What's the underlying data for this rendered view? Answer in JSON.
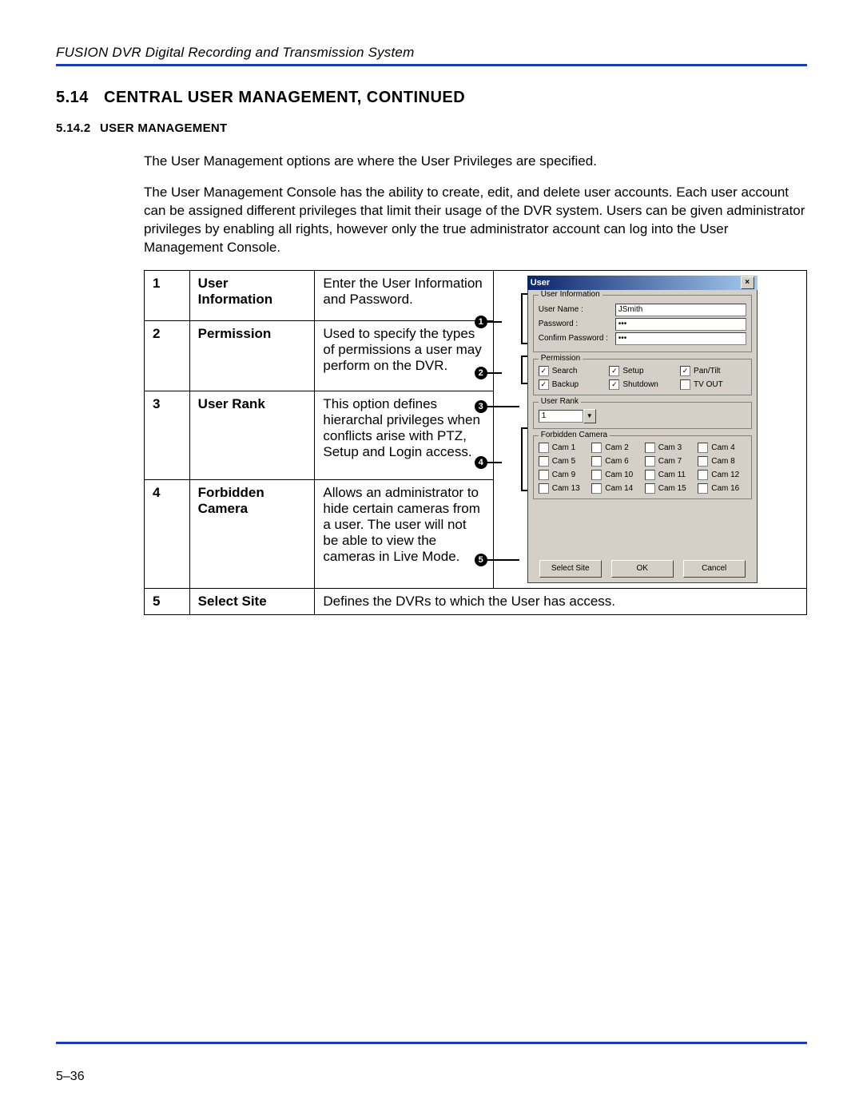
{
  "header": "FUSION DVR Digital Recording and Transmission System",
  "section": {
    "num": "5.14",
    "title": "CENTRAL USER MANAGEMENT, CONTINUED"
  },
  "subsection": {
    "num": "5.14.2",
    "title": "USER MANAGEMENT"
  },
  "para1": "The User Management options are where the User Privileges are specified.",
  "para2": "The User Management Console has the ability to create, edit, and delete user accounts. Each user account can be assigned different privileges that limit their usage of the DVR system. Users can be given administrator privileges by enabling all rights, however only the true administrator account can log into the User Management Console.",
  "defs": [
    {
      "n": "1",
      "term": "User Information",
      "desc": "Enter the User Information and Password."
    },
    {
      "n": "2",
      "term": "Permission",
      "desc": "Used to specify the types of permissions a user may perform on the DVR."
    },
    {
      "n": "3",
      "term": "User Rank",
      "desc": "This option defines hierarchal privileges when conflicts arise with PTZ, Setup and Login access."
    },
    {
      "n": "4",
      "term": "Forbidden Camera",
      "desc": "Allows an administrator to hide certain cameras from a user. The user will not be able to view the cameras in Live Mode."
    },
    {
      "n": "5",
      "term": "Select Site",
      "desc": "Defines the DVRs to which the User has access."
    }
  ],
  "dialog": {
    "title": "User",
    "group_userinfo": "User Information",
    "lbl_username": "User Name :",
    "val_username": "JSmith",
    "lbl_password": "Password :",
    "val_password": "•••",
    "lbl_confirm": "Confirm Password :",
    "val_confirm": "•••",
    "group_permission": "Permission",
    "perm": [
      {
        "label": "Search",
        "checked": true
      },
      {
        "label": "Setup",
        "checked": true
      },
      {
        "label": "Pan/Tilt",
        "checked": true
      },
      {
        "label": "Backup",
        "checked": true
      },
      {
        "label": "Shutdown",
        "checked": true
      },
      {
        "label": "TV OUT",
        "checked": false
      }
    ],
    "group_rank": "User Rank",
    "rank_value": "1",
    "group_forbidden": "Forbidden Camera",
    "cams": [
      "Cam 1",
      "Cam 2",
      "Cam 3",
      "Cam 4",
      "Cam 5",
      "Cam 6",
      "Cam 7",
      "Cam 8",
      "Cam 9",
      "Cam 10",
      "Cam 11",
      "Cam 12",
      "Cam 13",
      "Cam 14",
      "Cam 15",
      "Cam 16"
    ],
    "btn_select_site": "Select Site",
    "btn_ok": "OK",
    "btn_cancel": "Cancel"
  },
  "callouts": [
    "1",
    "2",
    "3",
    "4",
    "5"
  ],
  "page_num": "5–36"
}
